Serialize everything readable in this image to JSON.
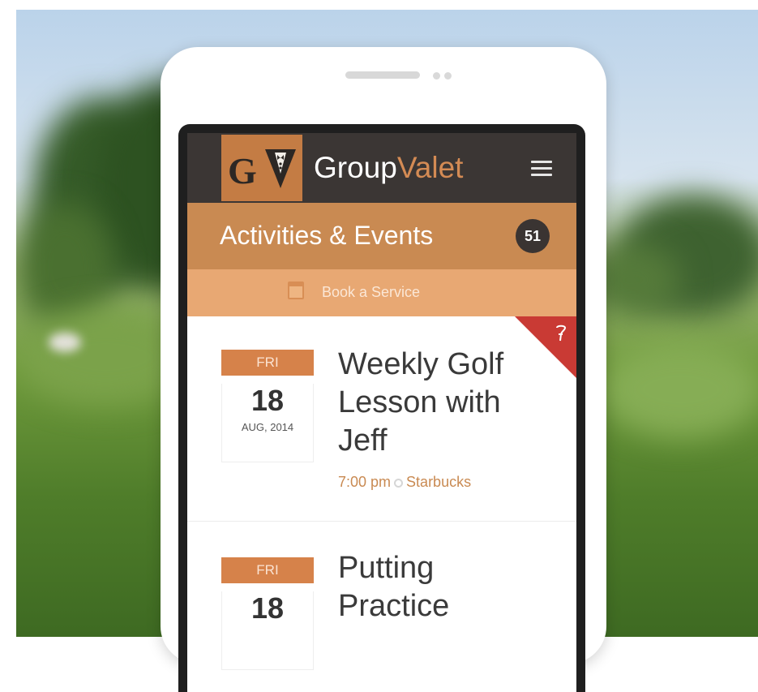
{
  "header": {
    "logo_letters": "GV",
    "brand_primary": "Group",
    "brand_accent": "Valet",
    "menu_icon": "hamburger-menu-icon"
  },
  "section": {
    "title": "Activities & Events",
    "count": "51"
  },
  "book_service": {
    "label": "Book a Service",
    "icon": "calendar-icon"
  },
  "events": [
    {
      "day": "FRI",
      "date": "18",
      "month_year": "AUG, 2014",
      "title": "Weekly Golf Lesson with Jeff",
      "time": "7:00 pm",
      "location": "Starbucks",
      "flag_icon": "golf-tee-icon"
    },
    {
      "day": "FRI",
      "date": "18",
      "title": "Putting Practice"
    }
  ],
  "colors": {
    "header_bg": "#3b3634",
    "accent_brown": "#c98a52",
    "book_bar": "#e8a873",
    "date_tag": "#d6824a",
    "badge_bg": "#3a3432",
    "flag_red": "#c93a34"
  }
}
